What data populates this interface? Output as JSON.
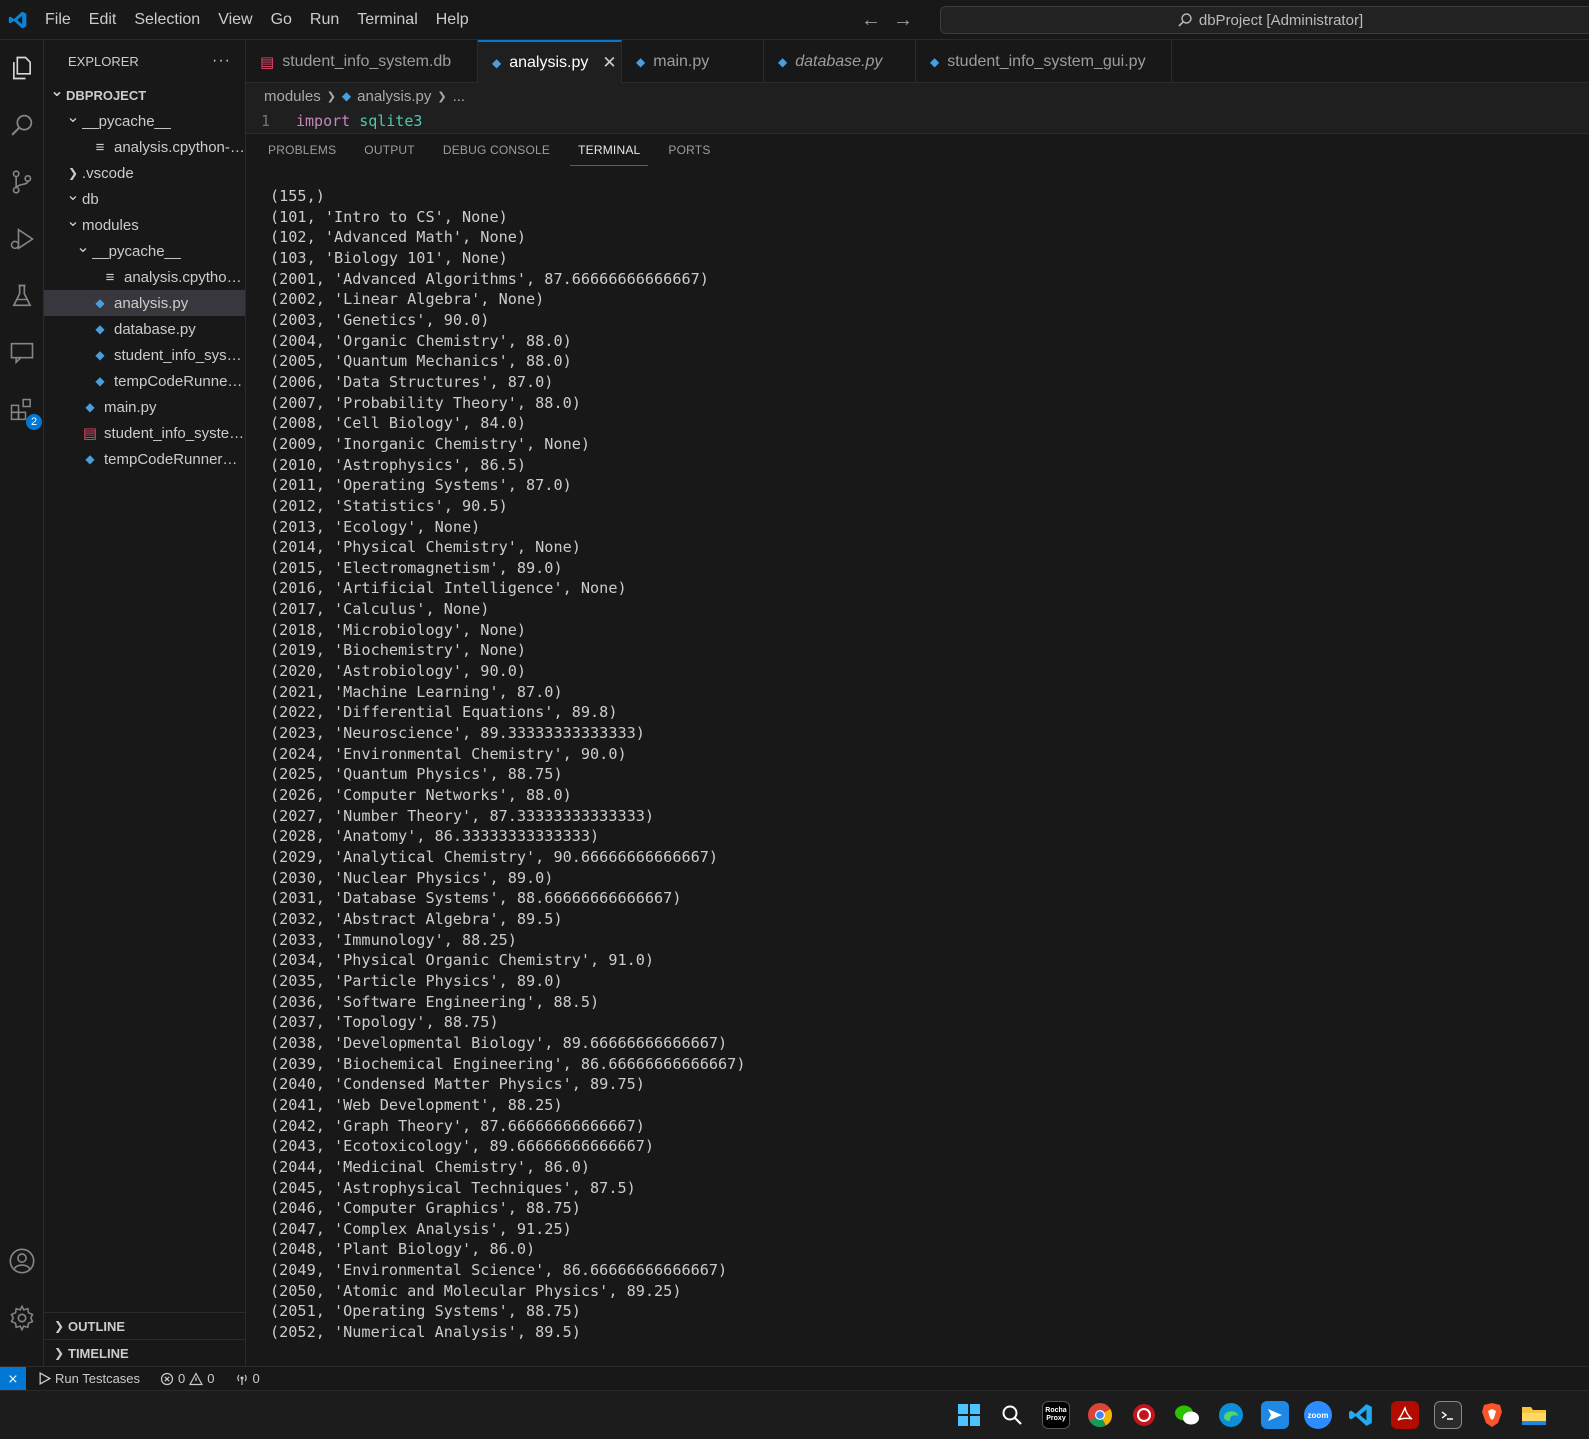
{
  "titlebar": {
    "menu": [
      "File",
      "Edit",
      "Selection",
      "View",
      "Go",
      "Run",
      "Terminal",
      "Help"
    ],
    "search_text": "dbProject [Administrator]"
  },
  "activitybar": {
    "extensions_badge": "2"
  },
  "sidebar": {
    "header": "EXPLORER",
    "more": "···",
    "tree": [
      {
        "label": "DBPROJECT",
        "depth": 0,
        "chevron": "open",
        "icon": "none",
        "root": true
      },
      {
        "label": "__pycache__",
        "depth": 1,
        "chevron": "open",
        "icon": "none"
      },
      {
        "label": "analysis.cpython-31...",
        "depth": 2,
        "chevron": "none",
        "icon": "txt"
      },
      {
        "label": ".vscode",
        "depth": 1,
        "chevron": "closed",
        "icon": "none"
      },
      {
        "label": "db",
        "depth": 1,
        "chevron": "open",
        "icon": "none"
      },
      {
        "label": "modules",
        "depth": 1,
        "chevron": "open",
        "icon": "none"
      },
      {
        "label": "__pycache__",
        "depth": 2,
        "chevron": "open",
        "icon": "none"
      },
      {
        "label": "analysis.cpython-3...",
        "depth": 3,
        "chevron": "none",
        "icon": "txt"
      },
      {
        "label": "analysis.py",
        "depth": 2,
        "chevron": "none",
        "icon": "py",
        "selected": true
      },
      {
        "label": "database.py",
        "depth": 2,
        "chevron": "none",
        "icon": "py"
      },
      {
        "label": "student_info_system...",
        "depth": 2,
        "chevron": "none",
        "icon": "py"
      },
      {
        "label": "tempCodeRunnerFil...",
        "depth": 2,
        "chevron": "none",
        "icon": "py"
      },
      {
        "label": "main.py",
        "depth": 1,
        "chevron": "none",
        "icon": "py"
      },
      {
        "label": "student_info_system.db",
        "depth": 1,
        "chevron": "none",
        "icon": "db"
      },
      {
        "label": "tempCodeRunnerFile....",
        "depth": 1,
        "chevron": "none",
        "icon": "py"
      }
    ],
    "outline": "OUTLINE",
    "timeline": "TIMELINE"
  },
  "tabs": [
    {
      "label": "student_info_system.db",
      "icon": "db",
      "active": false,
      "italic": false
    },
    {
      "label": "analysis.py",
      "icon": "py",
      "active": true,
      "italic": false
    },
    {
      "label": "main.py",
      "icon": "py",
      "active": false,
      "italic": false
    },
    {
      "label": "database.py",
      "icon": "py",
      "active": false,
      "italic": true
    },
    {
      "label": "student_info_system_gui.py",
      "icon": "py",
      "active": false,
      "italic": false
    }
  ],
  "breadcrumbs": {
    "folder": "modules",
    "file": "analysis.py",
    "more": "..."
  },
  "code": {
    "line_number": "1",
    "keyword": "import",
    "module": "sqlite3"
  },
  "panel": {
    "tabs": [
      "PROBLEMS",
      "OUTPUT",
      "DEBUG CONSOLE",
      "TERMINAL",
      "PORTS"
    ],
    "active_tab": "TERMINAL",
    "terminal_lines": [
      "(155,)",
      "(101, 'Intro to CS', None)",
      "(102, 'Advanced Math', None)",
      "(103, 'Biology 101', None)",
      "(2001, 'Advanced Algorithms', 87.66666666666667)",
      "(2002, 'Linear Algebra', None)",
      "(2003, 'Genetics', 90.0)",
      "(2004, 'Organic Chemistry', 88.0)",
      "(2005, 'Quantum Mechanics', 88.0)",
      "(2006, 'Data Structures', 87.0)",
      "(2007, 'Probability Theory', 88.0)",
      "(2008, 'Cell Biology', 84.0)",
      "(2009, 'Inorganic Chemistry', None)",
      "(2010, 'Astrophysics', 86.5)",
      "(2011, 'Operating Systems', 87.0)",
      "(2012, 'Statistics', 90.5)",
      "(2013, 'Ecology', None)",
      "(2014, 'Physical Chemistry', None)",
      "(2015, 'Electromagnetism', 89.0)",
      "(2016, 'Artificial Intelligence', None)",
      "(2017, 'Calculus', None)",
      "(2018, 'Microbiology', None)",
      "(2019, 'Biochemistry', None)",
      "(2020, 'Astrobiology', 90.0)",
      "(2021, 'Machine Learning', 87.0)",
      "(2022, 'Differential Equations', 89.8)",
      "(2023, 'Neuroscience', 89.33333333333333)",
      "(2024, 'Environmental Chemistry', 90.0)",
      "(2025, 'Quantum Physics', 88.75)",
      "(2026, 'Computer Networks', 88.0)",
      "(2027, 'Number Theory', 87.33333333333333)",
      "(2028, 'Anatomy', 86.33333333333333)",
      "(2029, 'Analytical Chemistry', 90.66666666666667)",
      "(2030, 'Nuclear Physics', 89.0)",
      "(2031, 'Database Systems', 88.66666666666667)",
      "(2032, 'Abstract Algebra', 89.5)",
      "(2033, 'Immunology', 88.25)",
      "(2034, 'Physical Organic Chemistry', 91.0)",
      "(2035, 'Particle Physics', 89.0)",
      "(2036, 'Software Engineering', 88.5)",
      "(2037, 'Topology', 88.75)",
      "(2038, 'Developmental Biology', 89.66666666666667)",
      "(2039, 'Biochemical Engineering', 86.66666666666667)",
      "(2040, 'Condensed Matter Physics', 89.75)",
      "(2041, 'Web Development', 88.25)",
      "(2042, 'Graph Theory', 87.66666666666667)",
      "(2043, 'Ecotoxicology', 89.66666666666667)",
      "(2044, 'Medicinal Chemistry', 86.0)",
      "(2045, 'Astrophysical Techniques', 87.5)",
      "(2046, 'Computer Graphics', 88.75)",
      "(2047, 'Complex Analysis', 91.25)",
      "(2048, 'Plant Biology', 86.0)",
      "(2049, 'Environmental Science', 86.66666666666667)",
      "(2050, 'Atomic and Molecular Physics', 89.25)",
      "(2051, 'Operating Systems', 88.75)",
      "(2052, 'Numerical Analysis', 89.5)"
    ]
  },
  "statusbar": {
    "run_testcases": "Run Testcases",
    "errors": "0",
    "warnings": "0",
    "ports": "0"
  },
  "taskbar": {
    "proxy_label": "Rocha Proxy",
    "zoom_label": "zoom"
  },
  "colors": {
    "accent": "#0078d4",
    "python_icon": "#4a9ede",
    "db_icon": "#e8476a",
    "keyword": "#c586c0",
    "module": "#4ec9b0"
  }
}
